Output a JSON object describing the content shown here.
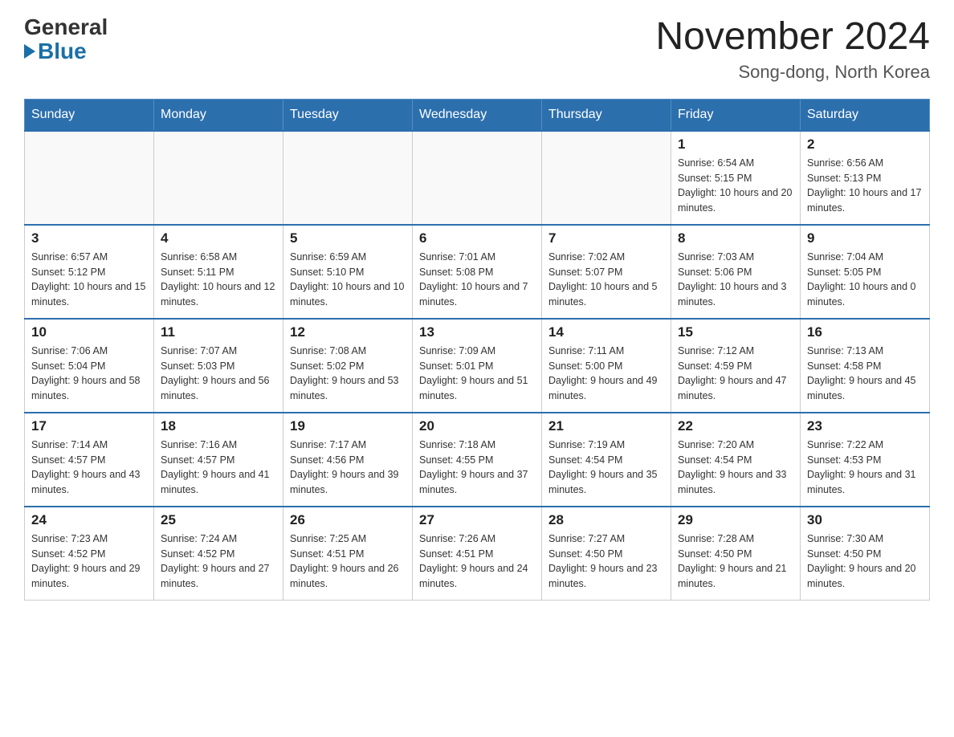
{
  "header": {
    "logo_general": "General",
    "logo_blue": "Blue",
    "title": "November 2024",
    "subtitle": "Song-dong, North Korea"
  },
  "days_of_week": [
    "Sunday",
    "Monday",
    "Tuesday",
    "Wednesday",
    "Thursday",
    "Friday",
    "Saturday"
  ],
  "weeks": [
    [
      {
        "day": "",
        "info": ""
      },
      {
        "day": "",
        "info": ""
      },
      {
        "day": "",
        "info": ""
      },
      {
        "day": "",
        "info": ""
      },
      {
        "day": "",
        "info": ""
      },
      {
        "day": "1",
        "info": "Sunrise: 6:54 AM\nSunset: 5:15 PM\nDaylight: 10 hours and 20 minutes."
      },
      {
        "day": "2",
        "info": "Sunrise: 6:56 AM\nSunset: 5:13 PM\nDaylight: 10 hours and 17 minutes."
      }
    ],
    [
      {
        "day": "3",
        "info": "Sunrise: 6:57 AM\nSunset: 5:12 PM\nDaylight: 10 hours and 15 minutes."
      },
      {
        "day": "4",
        "info": "Sunrise: 6:58 AM\nSunset: 5:11 PM\nDaylight: 10 hours and 12 minutes."
      },
      {
        "day": "5",
        "info": "Sunrise: 6:59 AM\nSunset: 5:10 PM\nDaylight: 10 hours and 10 minutes."
      },
      {
        "day": "6",
        "info": "Sunrise: 7:01 AM\nSunset: 5:08 PM\nDaylight: 10 hours and 7 minutes."
      },
      {
        "day": "7",
        "info": "Sunrise: 7:02 AM\nSunset: 5:07 PM\nDaylight: 10 hours and 5 minutes."
      },
      {
        "day": "8",
        "info": "Sunrise: 7:03 AM\nSunset: 5:06 PM\nDaylight: 10 hours and 3 minutes."
      },
      {
        "day": "9",
        "info": "Sunrise: 7:04 AM\nSunset: 5:05 PM\nDaylight: 10 hours and 0 minutes."
      }
    ],
    [
      {
        "day": "10",
        "info": "Sunrise: 7:06 AM\nSunset: 5:04 PM\nDaylight: 9 hours and 58 minutes."
      },
      {
        "day": "11",
        "info": "Sunrise: 7:07 AM\nSunset: 5:03 PM\nDaylight: 9 hours and 56 minutes."
      },
      {
        "day": "12",
        "info": "Sunrise: 7:08 AM\nSunset: 5:02 PM\nDaylight: 9 hours and 53 minutes."
      },
      {
        "day": "13",
        "info": "Sunrise: 7:09 AM\nSunset: 5:01 PM\nDaylight: 9 hours and 51 minutes."
      },
      {
        "day": "14",
        "info": "Sunrise: 7:11 AM\nSunset: 5:00 PM\nDaylight: 9 hours and 49 minutes."
      },
      {
        "day": "15",
        "info": "Sunrise: 7:12 AM\nSunset: 4:59 PM\nDaylight: 9 hours and 47 minutes."
      },
      {
        "day": "16",
        "info": "Sunrise: 7:13 AM\nSunset: 4:58 PM\nDaylight: 9 hours and 45 minutes."
      }
    ],
    [
      {
        "day": "17",
        "info": "Sunrise: 7:14 AM\nSunset: 4:57 PM\nDaylight: 9 hours and 43 minutes."
      },
      {
        "day": "18",
        "info": "Sunrise: 7:16 AM\nSunset: 4:57 PM\nDaylight: 9 hours and 41 minutes."
      },
      {
        "day": "19",
        "info": "Sunrise: 7:17 AM\nSunset: 4:56 PM\nDaylight: 9 hours and 39 minutes."
      },
      {
        "day": "20",
        "info": "Sunrise: 7:18 AM\nSunset: 4:55 PM\nDaylight: 9 hours and 37 minutes."
      },
      {
        "day": "21",
        "info": "Sunrise: 7:19 AM\nSunset: 4:54 PM\nDaylight: 9 hours and 35 minutes."
      },
      {
        "day": "22",
        "info": "Sunrise: 7:20 AM\nSunset: 4:54 PM\nDaylight: 9 hours and 33 minutes."
      },
      {
        "day": "23",
        "info": "Sunrise: 7:22 AM\nSunset: 4:53 PM\nDaylight: 9 hours and 31 minutes."
      }
    ],
    [
      {
        "day": "24",
        "info": "Sunrise: 7:23 AM\nSunset: 4:52 PM\nDaylight: 9 hours and 29 minutes."
      },
      {
        "day": "25",
        "info": "Sunrise: 7:24 AM\nSunset: 4:52 PM\nDaylight: 9 hours and 27 minutes."
      },
      {
        "day": "26",
        "info": "Sunrise: 7:25 AM\nSunset: 4:51 PM\nDaylight: 9 hours and 26 minutes."
      },
      {
        "day": "27",
        "info": "Sunrise: 7:26 AM\nSunset: 4:51 PM\nDaylight: 9 hours and 24 minutes."
      },
      {
        "day": "28",
        "info": "Sunrise: 7:27 AM\nSunset: 4:50 PM\nDaylight: 9 hours and 23 minutes."
      },
      {
        "day": "29",
        "info": "Sunrise: 7:28 AM\nSunset: 4:50 PM\nDaylight: 9 hours and 21 minutes."
      },
      {
        "day": "30",
        "info": "Sunrise: 7:30 AM\nSunset: 4:50 PM\nDaylight: 9 hours and 20 minutes."
      }
    ]
  ]
}
